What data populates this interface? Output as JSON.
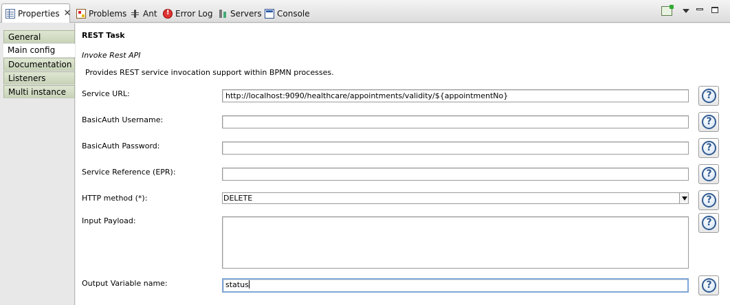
{
  "tabs": [
    {
      "label": "Properties",
      "icon": "properties-icon",
      "active": true
    },
    {
      "label": "Problems",
      "icon": "problems-icon"
    },
    {
      "label": "Ant",
      "icon": "ant-icon"
    },
    {
      "label": "Error Log",
      "icon": "error-log-icon"
    },
    {
      "label": "Servers",
      "icon": "servers-icon"
    },
    {
      "label": "Console",
      "icon": "console-icon"
    }
  ],
  "sidebar": {
    "items": [
      {
        "label": "General"
      },
      {
        "label": "Main config",
        "selected": true
      },
      {
        "label": "Documentation"
      },
      {
        "label": "Listeners"
      },
      {
        "label": "Multi instance"
      }
    ]
  },
  "main": {
    "title": "REST Task",
    "subtitle": "Invoke Rest API",
    "description": "Provides REST service invocation support within BPMN processes.",
    "fields": {
      "service_url": {
        "label": "Service URL:",
        "value": "http://localhost:9090/healthcare/appointments/validity/${appointmentNo}"
      },
      "basic_user": {
        "label": "BasicAuth Username:",
        "value": ""
      },
      "basic_pass": {
        "label": "BasicAuth Password:",
        "value": ""
      },
      "service_ref": {
        "label": "Service Reference (EPR):",
        "value": ""
      },
      "http_method": {
        "label": "HTTP method (*):",
        "value": "DELETE"
      },
      "input_payload": {
        "label": "Input Payload:",
        "value": ""
      },
      "output_var": {
        "label": "Output Variable name:",
        "value": "status"
      }
    },
    "help_glyph": "?"
  },
  "colors": {
    "sidebar_tab": "#cfd8c1",
    "help_accent": "#2f5a91",
    "focus_border": "#7ea6d6"
  }
}
